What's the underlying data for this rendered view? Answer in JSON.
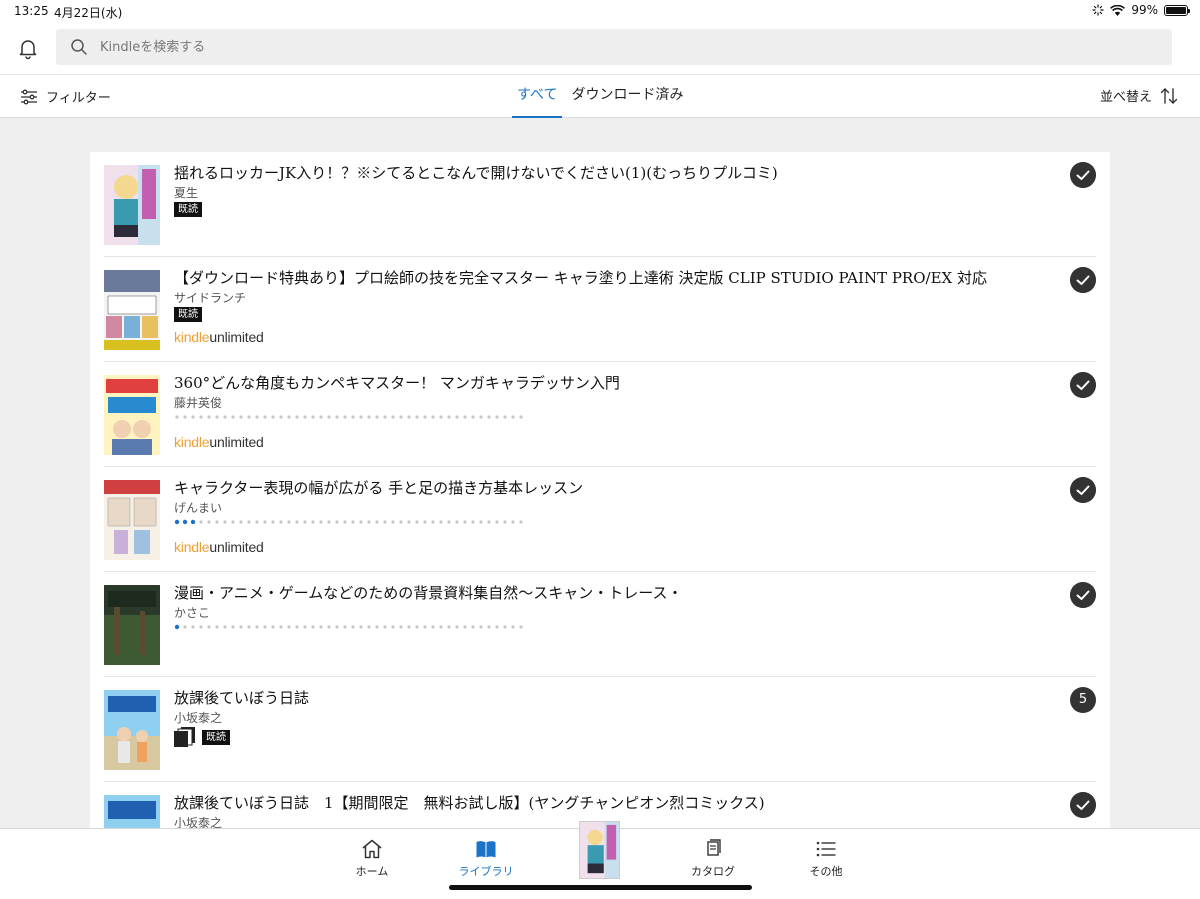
{
  "status_bar": {
    "time": "13:25",
    "date": "4月22日(水)",
    "battery": "99%",
    "battery_level": 0.99
  },
  "search": {
    "placeholder": "Kindleを検索する"
  },
  "filter": {
    "label": "フィルター"
  },
  "tabs": [
    {
      "label": "すべて",
      "active": true
    },
    {
      "label": "ダウンロード済み",
      "active": false
    }
  ],
  "sort": {
    "label": "並べ替え"
  },
  "books": [
    {
      "title": "揺れるロッカーJK入り！？※シてるとこなんで開けないでください(1)(むっちりプルコミ)",
      "author": "夏生",
      "read_badge": "既読",
      "progress": null,
      "kindle_unlimited": false,
      "status": "check"
    },
    {
      "title": "【ダウンロード特典あり】プロ絵師の技を完全マスター キャラ塗り上達術 決定版 CLIP STUDIO PAINT PRO/EX 対応",
      "author": "サイドランチ",
      "read_badge": "既読",
      "progress": null,
      "kindle_unlimited": true,
      "status": "check"
    },
    {
      "title": "360°どんな角度もカンペキマスター！ マンガキャラデッサン入門",
      "author": "藤井英俊",
      "read_badge": null,
      "progress": 0.0,
      "kindle_unlimited": true,
      "status": "check"
    },
    {
      "title": "キャラクター表現の幅が広がる 手と足の描き方基本レッスン",
      "author": "げんまい",
      "read_badge": null,
      "progress": 0.06,
      "kindle_unlimited": true,
      "status": "check"
    },
    {
      "title": "漫画・アニメ・ゲームなどのための背景資料集自然〜スキャン・トレース・",
      "author": "かさこ",
      "read_badge": null,
      "progress": 0.02,
      "kindle_unlimited": false,
      "status": "check"
    },
    {
      "title": "放課後ていぼう日誌",
      "author": "小坂泰之",
      "read_badge": "既読",
      "progress": null,
      "kindle_unlimited": false,
      "series": true,
      "status": "count",
      "count": "5"
    },
    {
      "title": "放課後ていぼう日誌　1【期間限定　無料お試し版】(ヤングチャンピオン烈コミックス)",
      "author": "小坂泰之",
      "read_badge": null,
      "progress": null,
      "kindle_unlimited": false,
      "status": "check"
    }
  ],
  "kindle_unlimited_logo": {
    "kindle": "kindle",
    "unlimited": "unlimited"
  },
  "bottom_nav": [
    {
      "label": "ホーム",
      "icon": "home-icon",
      "active": false
    },
    {
      "label": "ライブラリ",
      "icon": "book-icon",
      "active": true
    },
    {
      "label": "カタログ",
      "icon": "catalog-icon",
      "active": false
    },
    {
      "label": "その他",
      "icon": "menu-icon",
      "active": false
    }
  ],
  "colors": {
    "accent": "#1a73c7",
    "ku_orange": "#f0a030"
  }
}
